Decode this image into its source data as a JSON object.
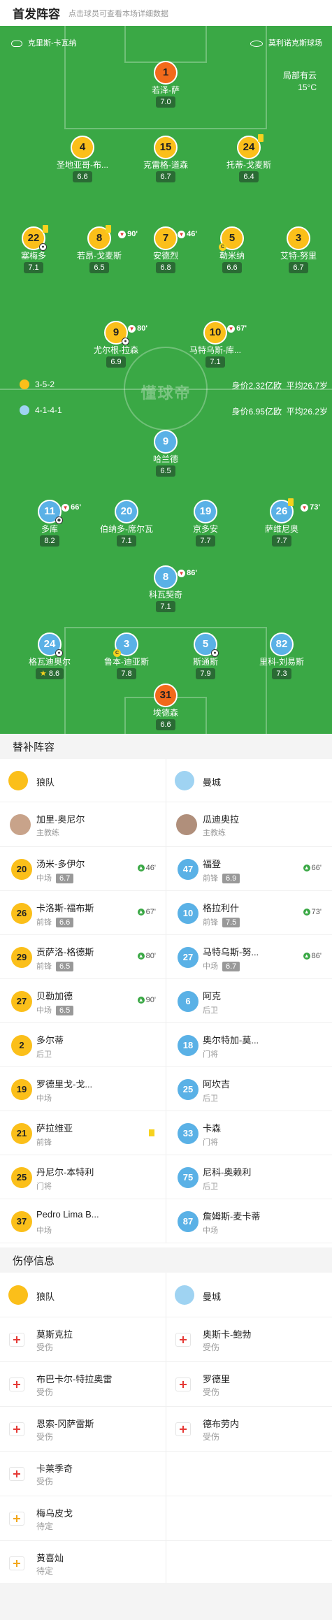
{
  "header": {
    "title": "首发阵容",
    "subtitle": "点击球员可查看本场详细数据"
  },
  "pitch_info": {
    "referee": "克里斯-卡瓦纳",
    "stadium": "莫利诺克斯球场",
    "weather": "局部有云",
    "temp": "15°C",
    "brand": "懂球帝"
  },
  "wolves_formation": {
    "shape": "3-5-2",
    "value": "身价2.32亿欧",
    "age": "平均26.7岁"
  },
  "city_formation": {
    "shape": "4-1-4-1",
    "value": "身价6.95亿欧",
    "age": "平均26.2岁"
  },
  "wolves_players": [
    {
      "num": "1",
      "name": "若泽-萨",
      "rating": "7.0"
    },
    {
      "num": "4",
      "name": "圣地亚哥-布...",
      "rating": "6.6"
    },
    {
      "num": "15",
      "name": "克雷格-道森",
      "rating": "6.7"
    },
    {
      "num": "24",
      "name": "托蒂-戈麦斯",
      "rating": "6.4"
    },
    {
      "num": "22",
      "name": "塞梅多",
      "rating": "7.1"
    },
    {
      "num": "8",
      "name": "若昂-戈麦斯",
      "rating": "6.5",
      "sub": "90'"
    },
    {
      "num": "7",
      "name": "安德烈",
      "rating": "6.8",
      "sub": "46'"
    },
    {
      "num": "5",
      "name": "勒米纳",
      "rating": "6.6"
    },
    {
      "num": "3",
      "name": "艾特-努里",
      "rating": "6.7"
    },
    {
      "num": "9",
      "name": "尤尔根-拉森",
      "rating": "6.9",
      "sub": "80'"
    },
    {
      "num": "10",
      "name": "马特乌斯-库...",
      "rating": "7.1",
      "sub": "67'"
    }
  ],
  "city_players": [
    {
      "num": "9",
      "name": "哈兰德",
      "rating": "6.5"
    },
    {
      "num": "11",
      "name": "多库",
      "rating": "8.2",
      "sub": "66'"
    },
    {
      "num": "20",
      "name": "伯纳多-席尔瓦",
      "rating": "7.1"
    },
    {
      "num": "19",
      "name": "京多安",
      "rating": "7.7"
    },
    {
      "num": "26",
      "name": "萨维尼奥",
      "rating": "7.7",
      "sub": "73'"
    },
    {
      "num": "8",
      "name": "科瓦契奇",
      "rating": "7.1",
      "sub": "86'"
    },
    {
      "num": "24",
      "name": "格瓦迪奥尔",
      "rating": "8.6"
    },
    {
      "num": "3",
      "name": "鲁本-迪亚斯",
      "rating": "7.8"
    },
    {
      "num": "5",
      "name": "斯通斯",
      "rating": "7.9"
    },
    {
      "num": "82",
      "name": "里科-刘易斯",
      "rating": "7.3"
    },
    {
      "num": "31",
      "name": "埃德森",
      "rating": "6.6"
    }
  ],
  "subs_title": "替补阵容",
  "teams": {
    "home": "狼队",
    "away": "曼城"
  },
  "coaches": {
    "home": {
      "name": "加里-奥尼尔",
      "role": "主教练"
    },
    "away": {
      "name": "瓜迪奥拉",
      "role": "主教练"
    }
  },
  "subs_home": [
    {
      "num": "20",
      "name": "汤米-多伊尔",
      "pos": "中场",
      "rating": "6.7",
      "sub": "46'"
    },
    {
      "num": "26",
      "name": "卡洛斯-福布斯",
      "pos": "前锋",
      "rating": "6.6",
      "sub": "67'"
    },
    {
      "num": "29",
      "name": "贡萨洛-格德斯",
      "pos": "前锋",
      "rating": "6.5",
      "sub": "80'"
    },
    {
      "num": "27",
      "name": "贝勒加德",
      "pos": "中场",
      "rating": "6.5",
      "sub": "90'"
    },
    {
      "num": "2",
      "name": "多尔蒂",
      "pos": "后卫"
    },
    {
      "num": "19",
      "name": "罗德里戈-戈...",
      "pos": "中场"
    },
    {
      "num": "21",
      "name": "萨拉维亚",
      "pos": "前锋",
      "yellow": true
    },
    {
      "num": "25",
      "name": "丹尼尔-本特利",
      "pos": "门将"
    },
    {
      "num": "37",
      "name": "Pedro Lima B...",
      "pos": "中场"
    }
  ],
  "subs_away": [
    {
      "num": "47",
      "name": "福登",
      "pos": "前锋",
      "rating": "6.9",
      "sub": "66'"
    },
    {
      "num": "10",
      "name": "格拉利什",
      "pos": "前锋",
      "rating": "7.5",
      "sub": "73'"
    },
    {
      "num": "27",
      "name": "马特乌斯-努...",
      "pos": "中场",
      "rating": "6.7",
      "sub": "86'"
    },
    {
      "num": "6",
      "name": "阿克",
      "pos": "后卫"
    },
    {
      "num": "18",
      "name": "奥尔特加-莫...",
      "pos": "门将"
    },
    {
      "num": "25",
      "name": "阿坎吉",
      "pos": "后卫"
    },
    {
      "num": "33",
      "name": "卡森",
      "pos": "门将"
    },
    {
      "num": "75",
      "name": "尼科-奥赖利",
      "pos": "后卫"
    },
    {
      "num": "87",
      "name": "詹姆斯-麦卡蒂",
      "pos": "中场"
    }
  ],
  "injury_title": "伤停信息",
  "injuries_home": [
    {
      "name": "莫斯克拉",
      "status": "受伤"
    },
    {
      "name": "布巴卡尔-特拉奥雷",
      "status": "受伤"
    },
    {
      "name": "恩索-冈萨雷斯",
      "status": "受伤"
    },
    {
      "name": "卡莱季奇",
      "status": "受伤"
    },
    {
      "name": "梅乌皮戈",
      "status": "待定"
    },
    {
      "name": "黄喜灿",
      "status": "待定"
    }
  ],
  "injuries_away": [
    {
      "name": "奥斯卡-鲍勃",
      "status": "受伤"
    },
    {
      "name": "罗德里",
      "status": "受伤"
    },
    {
      "name": "德布劳内",
      "status": "受伤"
    }
  ],
  "colors": {
    "pitch": "#3aa845",
    "wolves": "#fbbf1a",
    "city": "#5ab1e6",
    "keeper_home": "#f26a1b"
  }
}
